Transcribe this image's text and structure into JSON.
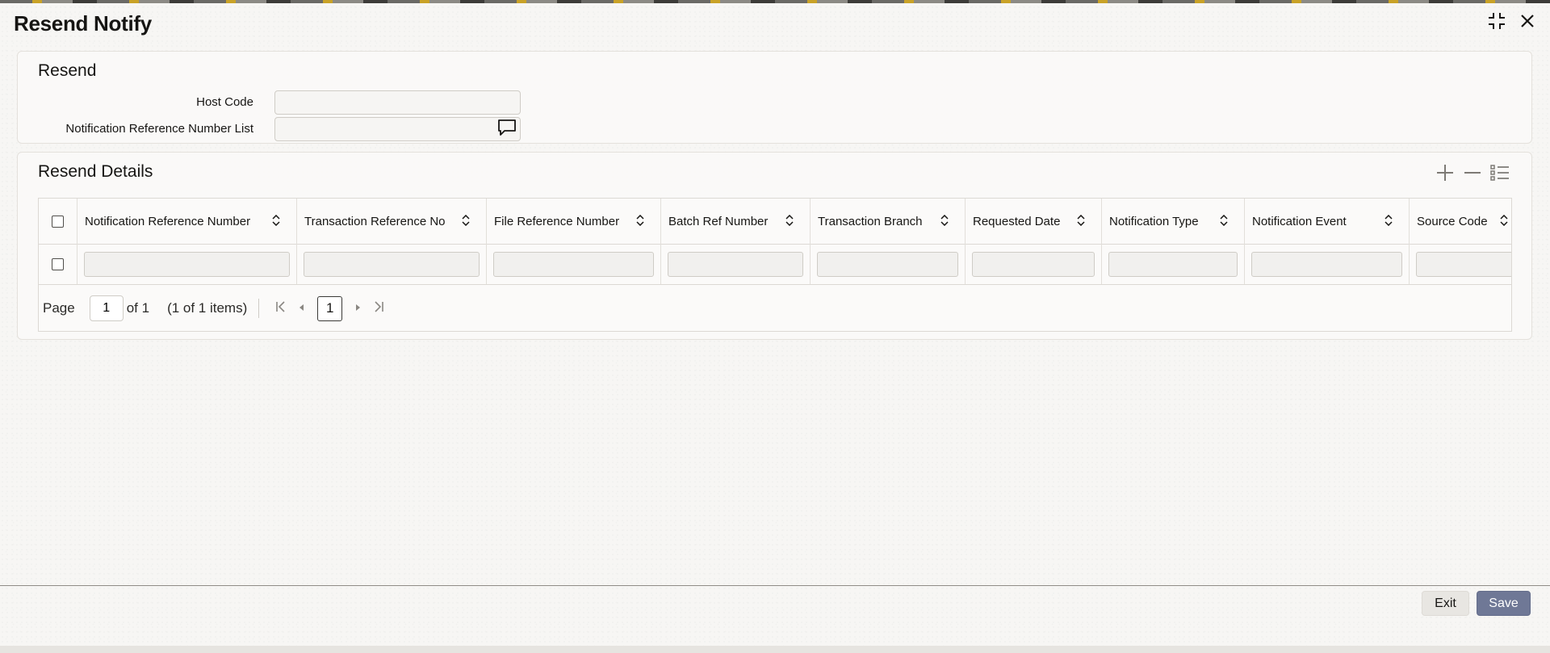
{
  "window": {
    "title": "Resend Notify",
    "controls": [
      {
        "name": "minimize-window-icon"
      },
      {
        "name": "close-icon"
      }
    ]
  },
  "resend": {
    "title": "Resend",
    "host_code": {
      "label": "Host Code",
      "value": "",
      "placeholder": ""
    },
    "notification_ref_list": {
      "label": "Notification Reference Number List",
      "value": "",
      "placeholder": ""
    }
  },
  "details": {
    "title": "Resend Details",
    "tools": [
      {
        "name": "add-row-icon"
      },
      {
        "name": "delete-row-icon"
      },
      {
        "name": "single-record-view-icon"
      }
    ],
    "columns": [
      "Notification Reference Number",
      "Transaction Reference No",
      "File Reference Number",
      "Batch Ref Number",
      "Transaction Branch",
      "Requested Date",
      "Notification Type",
      "Notification Event",
      "Source Code"
    ],
    "rows": [
      [
        "",
        "",
        "",
        "",
        "",
        "",
        "",
        "",
        ""
      ]
    ],
    "pager": {
      "page_label": "Page",
      "current_page": "1",
      "of_label": "of 1",
      "items_label": "(1 of 1 items)",
      "page_button": "1"
    }
  },
  "footer": {
    "exit_label": "Exit",
    "save_label": "Save"
  }
}
